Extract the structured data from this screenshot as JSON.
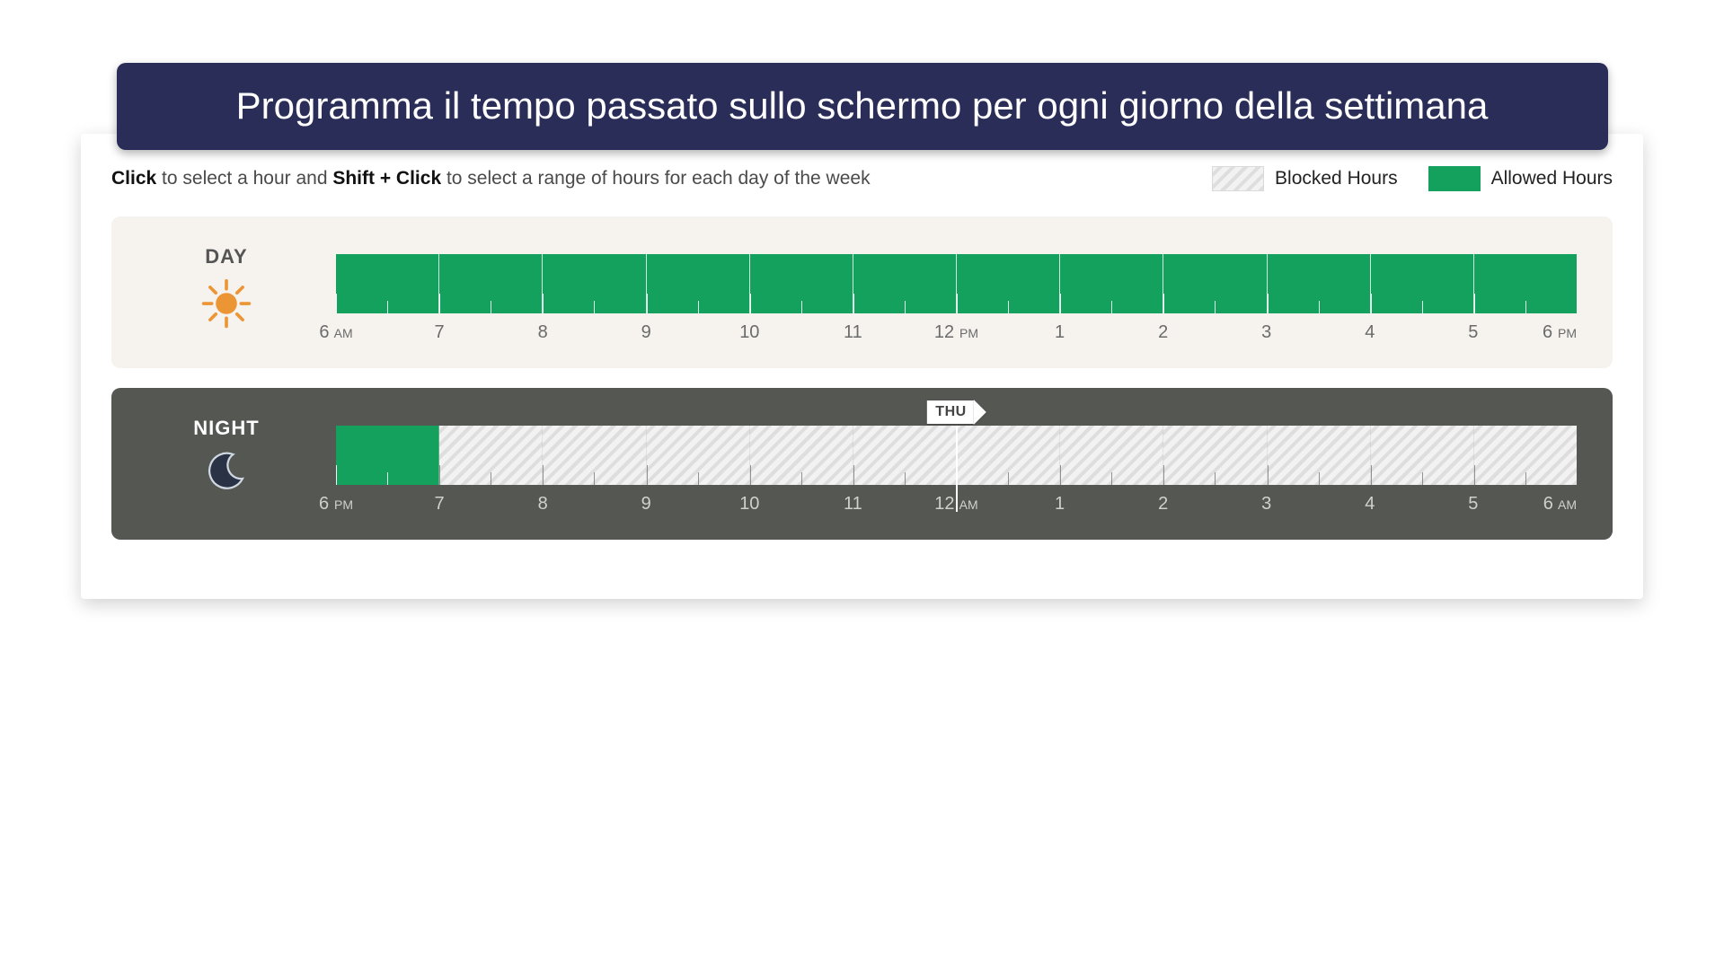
{
  "title": "Programma il tempo passato sullo schermo per ogni giorno della settimana",
  "instructions": {
    "click_strong": "Click",
    "click_tail": " to select a hour and ",
    "shift_strong": "Shift + Click",
    "shift_tail": " to select a range of hours for each day of the week"
  },
  "legend": {
    "blocked": "Blocked Hours",
    "allowed": "Allowed Hours"
  },
  "day": {
    "label": "DAY",
    "hours": [
      {
        "label": "6",
        "ampm": "AM",
        "state": "allowed"
      },
      {
        "label": "7",
        "ampm": "",
        "state": "allowed"
      },
      {
        "label": "8",
        "ampm": "",
        "state": "allowed"
      },
      {
        "label": "9",
        "ampm": "",
        "state": "allowed"
      },
      {
        "label": "10",
        "ampm": "",
        "state": "allowed"
      },
      {
        "label": "11",
        "ampm": "",
        "state": "allowed"
      },
      {
        "label": "12",
        "ampm": "PM",
        "state": "allowed"
      },
      {
        "label": "1",
        "ampm": "",
        "state": "allowed"
      },
      {
        "label": "2",
        "ampm": "",
        "state": "allowed"
      },
      {
        "label": "3",
        "ampm": "",
        "state": "allowed"
      },
      {
        "label": "4",
        "ampm": "",
        "state": "allowed"
      },
      {
        "label": "5",
        "ampm": "",
        "state": "allowed"
      }
    ],
    "end_label": "6",
    "end_ampm": "PM"
  },
  "night": {
    "label": "NIGHT",
    "hours": [
      {
        "label": "6",
        "ampm": "PM",
        "state": "allowed"
      },
      {
        "label": "7",
        "ampm": "",
        "state": "blocked"
      },
      {
        "label": "8",
        "ampm": "",
        "state": "blocked"
      },
      {
        "label": "9",
        "ampm": "",
        "state": "blocked"
      },
      {
        "label": "10",
        "ampm": "",
        "state": "blocked"
      },
      {
        "label": "11",
        "ampm": "",
        "state": "blocked"
      },
      {
        "label": "12",
        "ampm": "AM",
        "state": "blocked"
      },
      {
        "label": "1",
        "ampm": "",
        "state": "blocked"
      },
      {
        "label": "2",
        "ampm": "",
        "state": "blocked"
      },
      {
        "label": "3",
        "ampm": "",
        "state": "blocked"
      },
      {
        "label": "4",
        "ampm": "",
        "state": "blocked"
      },
      {
        "label": "5",
        "ampm": "",
        "state": "blocked"
      }
    ],
    "end_label": "6",
    "end_ampm": "AM",
    "marker": {
      "label": "THU",
      "position_index": 6
    }
  },
  "colors": {
    "allowed": "#14a15e",
    "title_bg": "#2a2d57",
    "night_bg": "#555753",
    "day_bg": "#f6f2ee",
    "sun": "#ec9535",
    "moon_fill": "#2a3246",
    "moon_edge": "#cfd7e0"
  }
}
